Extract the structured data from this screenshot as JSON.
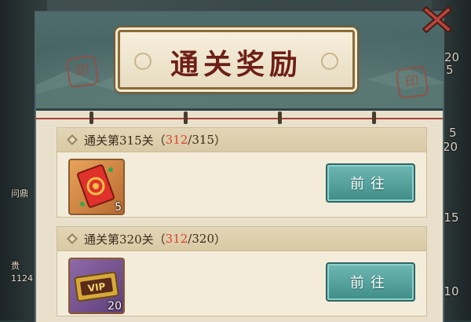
{
  "title": "通关奖励",
  "entries": [
    {
      "label": "通关第315关",
      "progress_open": "（ ",
      "current": "312",
      "target": "/315",
      "progress_close": " ）",
      "item": {
        "icon": "red-envelope-icon",
        "count": "5"
      },
      "button": "前往"
    },
    {
      "label": "通关第320关",
      "progress_open": "（ ",
      "current": "312",
      "target": "/320",
      "progress_close": " ）",
      "item": {
        "icon": "vip-card-icon",
        "count": "20"
      },
      "button": "前往"
    }
  ],
  "background": {
    "left_labels": [
      "问鼎",
      "贵",
      "1124"
    ],
    "right_numbers": [
      "20",
      "5",
      "5",
      "20",
      "-15",
      "-10"
    ]
  },
  "colors": {
    "accent_red": "#d84434",
    "button_teal": "#3f8d88",
    "panel_bg": "#e9e0cc"
  }
}
